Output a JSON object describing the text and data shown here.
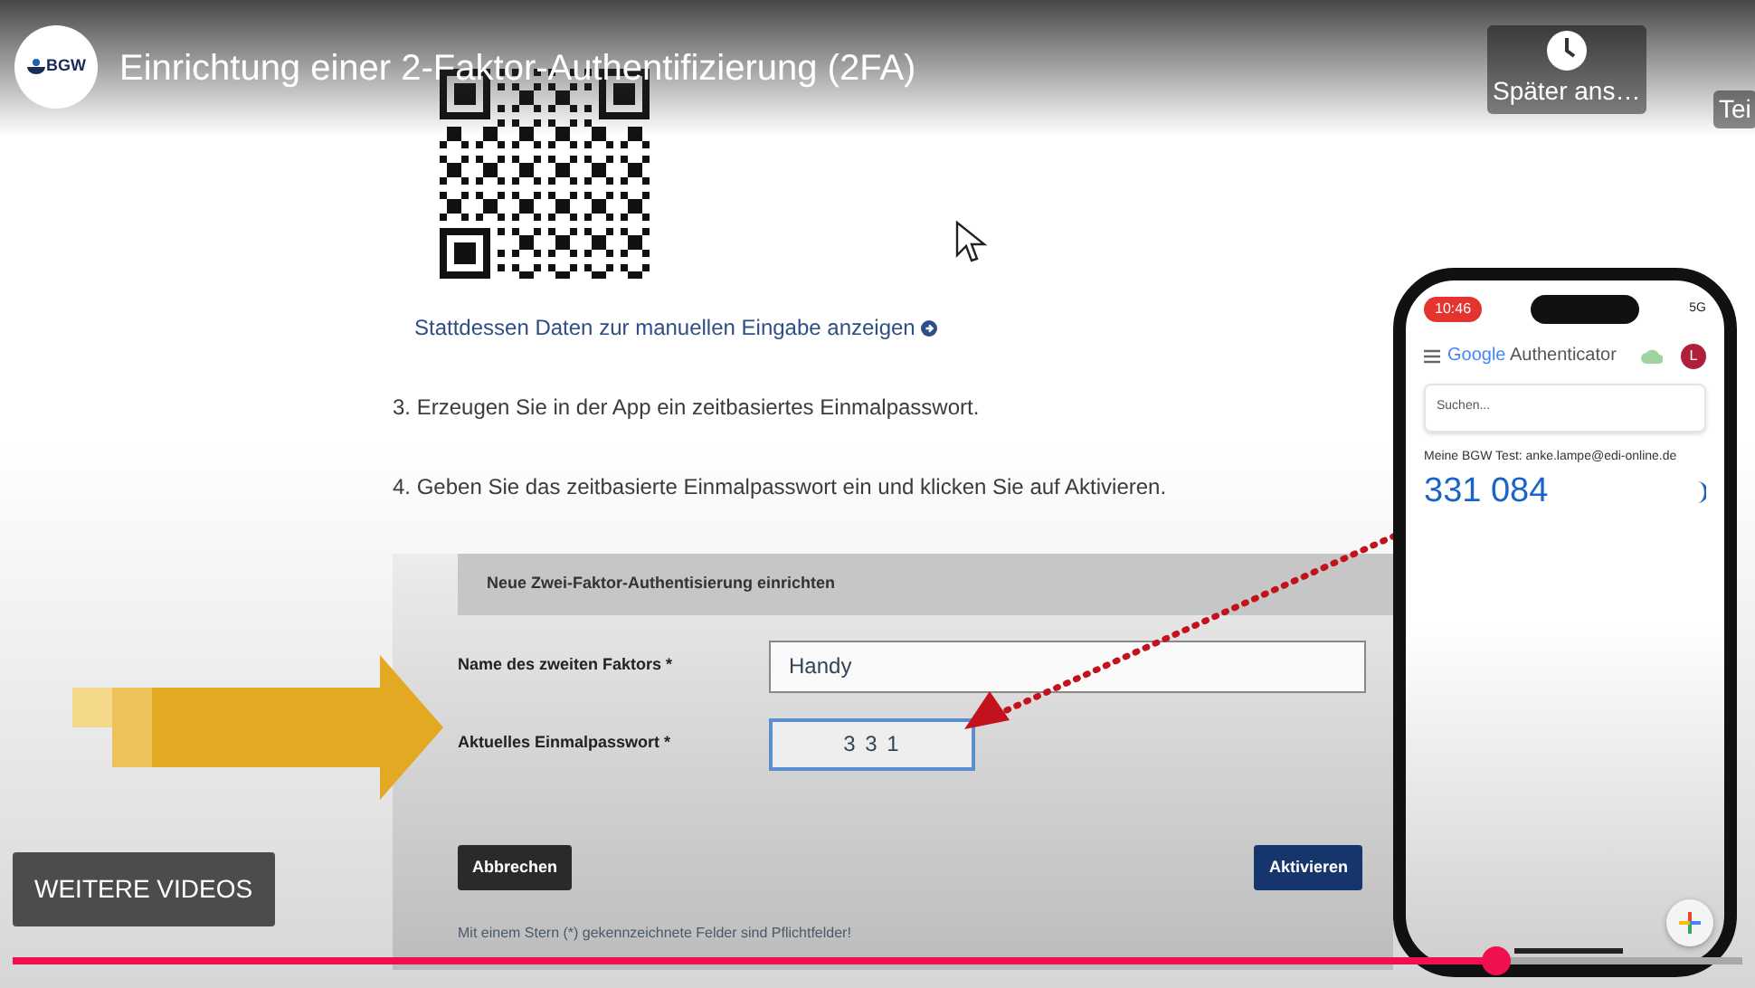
{
  "player": {
    "channel_logo": "BGW",
    "title": "Einrichtung einer 2-Faktor-Authentifizierung (2FA)",
    "watch_later": "Später ans…",
    "share": "Tei",
    "more_videos": "WEITERE VIDEOS",
    "progress": {
      "level": 0.858
    }
  },
  "page": {
    "manual_link": "Stattdessen Daten zur manuellen Eingabe anzeigen",
    "steps": [
      "3. Erzeugen Sie in der App ein zeitbasiertes Einmalpasswort.",
      "4. Geben Sie das zeitbasierte Einmalpasswort ein und klicken Sie auf Aktivieren."
    ],
    "form": {
      "title": "Neue Zwei-Faktor-Authentisierung einrichten",
      "fields": [
        {
          "label": "Name des zweiten Faktors *",
          "value": "Handy",
          "focused": false
        },
        {
          "label": "Aktuelles Einmalpasswort *",
          "value": "3 3 1",
          "focused": true
        }
      ],
      "buttons": [
        {
          "label": "Abbrechen",
          "kind": "secondary"
        },
        {
          "label": "Aktivieren",
          "kind": "primary"
        }
      ],
      "note": "Mit einem Stern (*) gekennzeichnete Felder sind Pflichtfelder!"
    }
  },
  "phone": {
    "time": "10:46",
    "network": "5G",
    "brand": "Google",
    "app": "Authenticator",
    "avatar": "L",
    "search_placeholder": "Suchen...",
    "account": "Meine BGW Test: anke.lampe@edi-online.de",
    "code": "331 084"
  }
}
